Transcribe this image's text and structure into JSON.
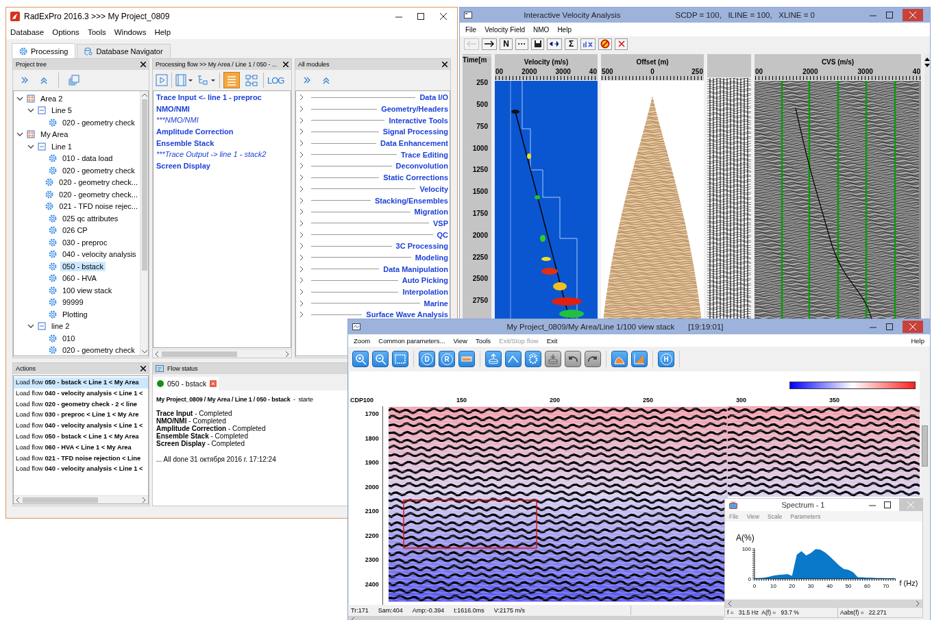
{
  "main_window": {
    "title": "RadExPro 2016.3 >>> My Project_0809",
    "menu": [
      "Database",
      "Options",
      "Tools",
      "Windows",
      "Help"
    ],
    "tabs": [
      {
        "label": "Processing",
        "selected": true
      },
      {
        "label": "Database Navigator",
        "selected": false
      }
    ],
    "project_tree": {
      "title": "Project tree",
      "nodes": [
        {
          "label": "Area 2",
          "kind": "area",
          "expanded": true,
          "selected": false,
          "children": [
            {
              "label": "Line 5",
              "kind": "line",
              "expanded": true,
              "selected": false,
              "children": [
                {
                  "label": "020 - geometry check",
                  "kind": "flow",
                  "selected": false
                }
              ]
            }
          ]
        },
        {
          "label": "My Area",
          "kind": "area",
          "expanded": true,
          "selected": false,
          "children": [
            {
              "label": "Line 1",
              "kind": "line",
              "expanded": true,
              "selected": false,
              "children": [
                {
                  "label": "010 - data load",
                  "kind": "flow",
                  "selected": false
                },
                {
                  "label": "020 - geometry check",
                  "kind": "flow",
                  "selected": false
                },
                {
                  "label": "020 - geometry check...",
                  "kind": "flow",
                  "selected": false
                },
                {
                  "label": "020 - geometry check...",
                  "kind": "flow",
                  "selected": false
                },
                {
                  "label": "021 - TFD noise rejec...",
                  "kind": "flow",
                  "selected": false
                },
                {
                  "label": "025 qc attributes",
                  "kind": "flow",
                  "selected": false
                },
                {
                  "label": "026 CP",
                  "kind": "flow",
                  "selected": false
                },
                {
                  "label": "030 - preproc",
                  "kind": "flow",
                  "selected": false
                },
                {
                  "label": "040 - velocity analysis",
                  "kind": "flow",
                  "selected": false
                },
                {
                  "label": "050 - bstack",
                  "kind": "flow",
                  "selected": true
                },
                {
                  "label": "060 - HVA",
                  "kind": "flow",
                  "selected": false
                },
                {
                  "label": "100 view stack",
                  "kind": "flow",
                  "selected": false
                },
                {
                  "label": "99999",
                  "kind": "flow",
                  "selected": false
                },
                {
                  "label": "Plotting",
                  "kind": "flow",
                  "selected": false
                }
              ]
            },
            {
              "label": "line 2",
              "kind": "line",
              "expanded": true,
              "selected": false,
              "children": [
                {
                  "label": "010",
                  "kind": "flow",
                  "selected": false
                },
                {
                  "label": "020 - geometry check",
                  "kind": "flow",
                  "selected": false
                }
              ]
            }
          ]
        }
      ]
    },
    "flow": {
      "title": "Processing flow >> My Area / Line 1 / 050 - ...",
      "log_label": "LOG",
      "view_modes": [
        {
          "kind": "list",
          "selected": true
        },
        {
          "kind": "diagram",
          "selected": false
        }
      ],
      "items": [
        {
          "label": "Trace Input <- line 1 - preproc",
          "kind": "module"
        },
        {
          "label": "NMO/NMI",
          "kind": "module"
        },
        {
          "label": "***NMO/NMI",
          "kind": "commented"
        },
        {
          "label": "Amplitude Correction",
          "kind": "module"
        },
        {
          "label": "Ensemble Stack",
          "kind": "module"
        },
        {
          "label": "***Trace Output -> line 1 - stack2",
          "kind": "commented"
        },
        {
          "label": "Screen Display",
          "kind": "module"
        }
      ]
    },
    "modules": {
      "title": "All modules",
      "items": [
        {
          "label": "Data I/O",
          "expanded": false
        },
        {
          "label": "Geometry/Headers",
          "expanded": false
        },
        {
          "label": "Interactive Tools",
          "expanded": false
        },
        {
          "label": "Signal Processing",
          "expanded": false
        },
        {
          "label": "Data Enhancement",
          "expanded": false
        },
        {
          "label": "Trace Editing",
          "expanded": false
        },
        {
          "label": "Deconvolution",
          "expanded": false
        },
        {
          "label": "Static Corrections",
          "expanded": false
        },
        {
          "label": "Velocity",
          "expanded": false
        },
        {
          "label": "Stacking/Ensembles",
          "expanded": false
        },
        {
          "label": "Migration",
          "expanded": false
        },
        {
          "label": "VSP",
          "expanded": false
        },
        {
          "label": "QC",
          "expanded": false
        },
        {
          "label": "3C Processing",
          "expanded": false
        },
        {
          "label": "Modeling",
          "expanded": false
        },
        {
          "label": "Data Manipulation",
          "expanded": false
        },
        {
          "label": "Auto Picking",
          "expanded": false
        },
        {
          "label": "Interpolation",
          "expanded": false
        },
        {
          "label": "Marine",
          "expanded": false
        },
        {
          "label": "Surface Wave Analysis",
          "expanded": false
        }
      ]
    },
    "actions": {
      "title": "Actions",
      "items": [
        {
          "text": "Load flow **050 - bstack < Line 1 < My Area**",
          "selected": true
        },
        {
          "text": "Load flow **040 - velocity analysis < Line 1 <**",
          "selected": false
        },
        {
          "text": "Load flow **020 - geometry check - 2 < line**",
          "selected": false
        },
        {
          "text": "Load flow **030 - preproc < Line 1 < My Are**",
          "selected": false
        },
        {
          "text": "Load flow **040 - velocity analysis < Line 1 <**",
          "selected": false
        },
        {
          "text": "Load flow **050 - bstack < Line 1 < My Area**",
          "selected": false
        },
        {
          "text": "Load flow **060 - HVA < Line 1 < My Area**",
          "selected": false
        },
        {
          "text": "Load flow **021 - TFD noise rejection < Line**",
          "selected": false
        },
        {
          "text": "Load flow **040 - velocity analysis < Line 1 <**",
          "selected": false
        }
      ]
    },
    "flow_status": {
      "title": "Flow status",
      "tab": "050 - bstack",
      "heading": "**My Project_0809 / My Area / Line 1 / 050 - bstack**  -  starte",
      "results": [
        "**Trace Input** - Completed",
        "**NMO/NMI** - Completed",
        "**Amplitude Correction** - Completed",
        "**Ensemble Stack** - Completed",
        "**Screen Display** - Completed"
      ],
      "done": "... All done 31 октября 2016 г. 17:12:24"
    }
  },
  "velocity_window": {
    "title": "Interactive Velocity Analysis",
    "info": "SCDP = 100,   ILINE = 100,   XLINE = 0",
    "menu": [
      "File",
      "Velocity Field",
      "NMO",
      "Help"
    ],
    "toolbar": [
      {
        "kind": "back",
        "disabled": true
      },
      {
        "kind": "forward",
        "disabled": false
      },
      {
        "kind": "text",
        "label": "N",
        "disabled": false
      },
      {
        "kind": "text",
        "label": "···",
        "disabled": false
      },
      {
        "kind": "save",
        "disabled": false
      },
      {
        "kind": "swap",
        "disabled": false
      },
      {
        "kind": "text",
        "label": "Σ",
        "disabled": false
      },
      {
        "kind": "mix",
        "disabled": false
      },
      {
        "kind": "stop",
        "disabled": false
      },
      {
        "kind": "close",
        "disabled": false
      }
    ],
    "time_axis": {
      "label": "Time[m",
      "ticks": [
        "250",
        "500",
        "750",
        "1000",
        "1250",
        "1500",
        "1750",
        "2000",
        "2250",
        "2500",
        "2750"
      ]
    },
    "panels": [
      {
        "kind": "semblance",
        "title": "Velocity (m/s)",
        "ticks": [
          "00",
          "2000",
          "3000",
          "40"
        ]
      },
      {
        "kind": "gather",
        "title": "Offset (m)",
        "ticks": [
          "500",
          "0",
          "250"
        ]
      },
      {
        "kind": "traces"
      },
      {
        "kind": "cvs",
        "title": "CVS (m/s)",
        "ticks": [
          "00",
          "2000",
          "3000",
          "40"
        ]
      }
    ]
  },
  "stack_window": {
    "title": "My Project_0809/My Area/Line 1/100 view stack",
    "time": "[19:19:01]",
    "menu": [
      {
        "label": "Zoom",
        "disabled": false
      },
      {
        "label": "Common parameters...",
        "disabled": false
      },
      {
        "label": "View",
        "disabled": false
      },
      {
        "label": "Tools",
        "disabled": false
      },
      {
        "label": "Exit/Stop flow",
        "disabled": true
      },
      {
        "label": "Exit",
        "disabled": false
      }
    ],
    "help": "Help",
    "toolbar": [
      {
        "kind": "zoom-in",
        "disabled": false
      },
      {
        "kind": "zoom-out",
        "disabled": false
      },
      {
        "kind": "frame",
        "disabled": false
      },
      {
        "kind": "letter",
        "label": "D",
        "disabled": false
      },
      {
        "kind": "letter",
        "label": "R",
        "disabled": false
      },
      {
        "kind": "ruler",
        "disabled": false
      },
      {
        "kind": "db-up",
        "disabled": false
      },
      {
        "kind": "polyline",
        "disabled": false
      },
      {
        "kind": "gear",
        "disabled": false
      },
      {
        "kind": "db-down",
        "disabled": true
      },
      {
        "kind": "undo",
        "disabled": true
      },
      {
        "kind": "redo",
        "disabled": true
      },
      {
        "kind": "area",
        "disabled": false
      },
      {
        "kind": "wedge",
        "disabled": false
      },
      {
        "kind": "letter",
        "label": "H",
        "disabled": false
      }
    ],
    "cdp_label": "CDP",
    "cdp_ticks": [
      "100",
      "150",
      "200",
      "250",
      "300",
      "350"
    ],
    "time_ticks": [
      "1700",
      "1800",
      "1900",
      "2000",
      "2100",
      "2200",
      "2300",
      "2400"
    ],
    "status": [
      "Tr:171",
      "Sam:404",
      "Amp:-0.394",
      "t:1616.0ms",
      "V:2175 m/s"
    ]
  },
  "spectrum_window": {
    "title": "Spectrum - 1",
    "menu": [
      "File",
      "View",
      "Scale",
      "Parameters"
    ],
    "chart_data": {
      "type": "area",
      "xlabel": "f (Hz)",
      "ylabel": "A(%)",
      "x": [
        0,
        2.5,
        5,
        7.5,
        10,
        12.5,
        15,
        17.5,
        20,
        22.5,
        25,
        27.5,
        30,
        32.5,
        35,
        37.5,
        40,
        42.5,
        45,
        47.5,
        50,
        52.5,
        55,
        57.5,
        60,
        62.5,
        65,
        67.5,
        70,
        72.5,
        75
      ],
      "values": [
        3,
        3,
        4,
        7,
        11,
        13,
        14,
        16,
        10,
        80,
        92,
        78,
        86,
        99,
        97,
        88,
        75,
        60,
        45,
        33,
        30,
        22,
        6,
        5,
        4,
        4,
        3,
        3,
        2,
        2,
        2
      ],
      "xlim": [
        0,
        75
      ],
      "ylim": [
        0,
        100
      ],
      "xticks": [
        0,
        10,
        20,
        30,
        40,
        50,
        60,
        70
      ],
      "yticks": [
        0,
        100
      ]
    },
    "status": [
      "f =   31.5 Hz  A(f) =   93.7 %",
      "Aabs(f) =   22.271"
    ]
  }
}
